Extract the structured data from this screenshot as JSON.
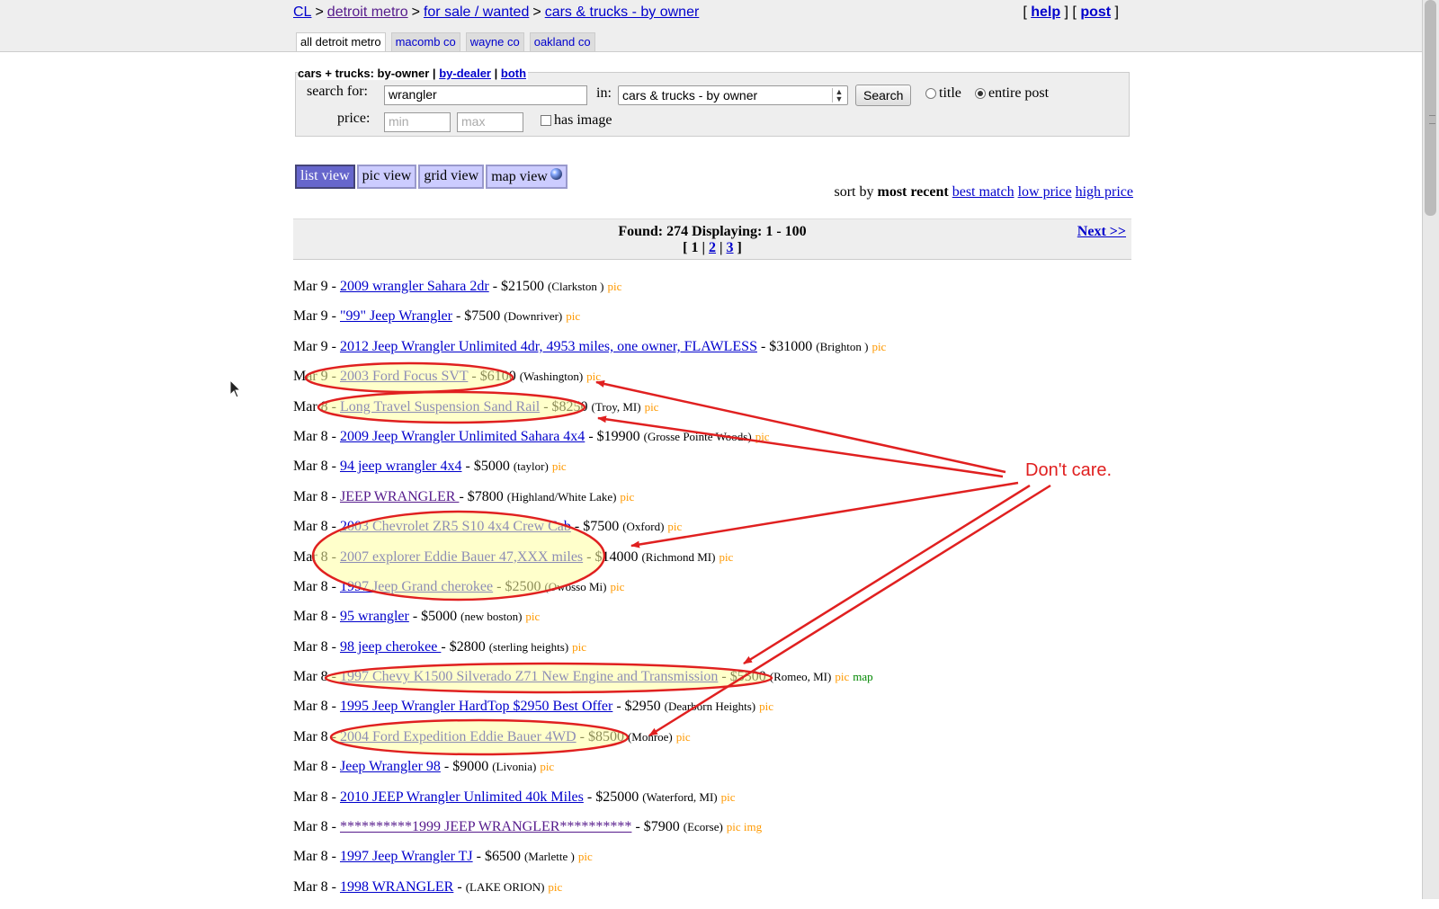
{
  "breadcrumb": [
    "CL",
    "detroit metro",
    "for sale / wanted",
    "cars & trucks - by owner"
  ],
  "breadcrumb_sep": ">",
  "header_links": {
    "help": "help",
    "post": "post"
  },
  "area_tabs": [
    {
      "label": "all detroit metro",
      "active": true
    },
    {
      "label": "macomb co",
      "active": false
    },
    {
      "label": "wayne co",
      "active": false
    },
    {
      "label": "oakland co",
      "active": false
    }
  ],
  "search": {
    "category_title": "cars + trucks: by-owner",
    "category_links": [
      "by-dealer",
      "both"
    ],
    "search_for_label": "search for:",
    "query": "wrangler",
    "in_label": "in:",
    "category_select": "cars & trucks - by owner",
    "search_button": "Search",
    "radio_title": "title",
    "radio_entire": "entire post",
    "price_label": "price:",
    "min_placeholder": "min",
    "max_placeholder": "max",
    "has_image": "has image"
  },
  "views": {
    "list": "list view",
    "pic": "pic view",
    "grid": "grid view",
    "map": "map view"
  },
  "sort": {
    "prefix": "sort by",
    "current": "most recent",
    "options": [
      "best match",
      "low price",
      "high price"
    ]
  },
  "results": {
    "found": "Found: 274 Displaying: 1 - 100",
    "pages": [
      "1",
      "2",
      "3"
    ],
    "next": "Next >>"
  },
  "listings": [
    {
      "date": "Mar 9",
      "title": "2009 wrangler Sahara 2dr",
      "price": "$21500",
      "loc": "(Clarkston )",
      "tags": "pic",
      "visited": false
    },
    {
      "date": "Mar 9",
      "title": "\"99\" Jeep Wrangler",
      "price": "$7500",
      "loc": "(Downriver)",
      "tags": "pic",
      "visited": false
    },
    {
      "date": "Mar 9",
      "title": "2012 Jeep Wrangler Unlimited 4dr, 4953 miles, one owner, FLAWLESS",
      "price": "$31000",
      "loc": "(Brighton )",
      "tags": "pic",
      "visited": false
    },
    {
      "date": "Mar 9",
      "title": "2003 Ford Focus SVT",
      "price": "$6100",
      "loc": "(Washington)",
      "tags": "pic",
      "visited": false
    },
    {
      "date": "Mar 8",
      "title": "Long Travel Suspension Sand Rail",
      "price": "$8250",
      "loc": "(Troy, MI)",
      "tags": "pic",
      "visited": false
    },
    {
      "date": "Mar 8",
      "title": "2009 Jeep Wrangler Unlimited Sahara 4x4",
      "price": "$19900",
      "loc": "(Grosse Pointe Woods)",
      "tags": "pic",
      "visited": false
    },
    {
      "date": "Mar 8",
      "title": "94 jeep wrangler 4x4",
      "price": "$5000",
      "loc": "(taylor)",
      "tags": "pic",
      "visited": false
    },
    {
      "date": "Mar 8",
      "title": "JEEP WRANGLER ",
      "price": "$7800",
      "loc": "(Highland/White Lake)",
      "tags": "pic",
      "visited": true
    },
    {
      "date": "Mar 8",
      "title": "2003 Chevrolet ZR5 S10 4x4 Crew Cab",
      "price": "$7500",
      "loc": "(Oxford)",
      "tags": "pic",
      "visited": false
    },
    {
      "date": "Mar 8",
      "title": "2007 explorer Eddie Bauer 47,XXX miles",
      "price": "$14000",
      "loc": "(Richmond MI)",
      "tags": "pic",
      "visited": false
    },
    {
      "date": "Mar 8",
      "title": "1997 Jeep Grand cherokee",
      "price": "$2500",
      "loc": "(Owosso Mi)",
      "tags": "pic",
      "visited": false
    },
    {
      "date": "Mar 8",
      "title": "95 wrangler",
      "price": "$5000",
      "loc": "(new boston)",
      "tags": "pic",
      "visited": false
    },
    {
      "date": "Mar 8",
      "title": "98 jeep cherokee ",
      "price": "$2800",
      "loc": "(sterling heights)",
      "tags": "pic",
      "visited": false
    },
    {
      "date": "Mar 8",
      "title": "1997 Chevy K1500 Silverado Z71 New Engine and Transmission",
      "price": "$5500",
      "loc": "(Romeo, MI)",
      "tags": "pic",
      "map": "map",
      "visited": false
    },
    {
      "date": "Mar 8",
      "title": "1995 Jeep Wrangler HardTop $2950 Best Offer",
      "price": "$2950",
      "loc": "(Dearborn Heights)",
      "tags": "pic",
      "visited": false
    },
    {
      "date": "Mar 8",
      "title": "2004 Ford Expedition Eddie Bauer 4WD",
      "price": "$8500",
      "loc": "(Monroe)",
      "tags": "pic",
      "visited": false
    },
    {
      "date": "Mar 8",
      "title": "Jeep Wrangler 98",
      "price": "$9000",
      "loc": "(Livonia)",
      "tags": "pic",
      "visited": false
    },
    {
      "date": "Mar 8",
      "title": "2010 JEEP Wrangler Unlimited 40k Miles",
      "price": "$25000",
      "loc": "(Waterford, MI)",
      "tags": "pic",
      "visited": false
    },
    {
      "date": "Mar 8",
      "title": "**********1999 JEEP WRANGLER**********",
      "price": "$7900",
      "loc": "(Ecorse)",
      "tags": "pic img",
      "visited": true
    },
    {
      "date": "Mar 8",
      "title": "1997 Jeep Wrangler TJ",
      "price": "$6500",
      "loc": "(Marlette )",
      "tags": "pic",
      "visited": false
    },
    {
      "date": "Mar 8",
      "title": "1998 WRANGLER",
      "price": "",
      "loc": "(LAKE ORION)",
      "tags": "pic",
      "visited": false
    }
  ],
  "annotation": {
    "text": "Don't care.",
    "color": "#e02020",
    "circled_rows": [
      3,
      4,
      9,
      13,
      15
    ]
  }
}
